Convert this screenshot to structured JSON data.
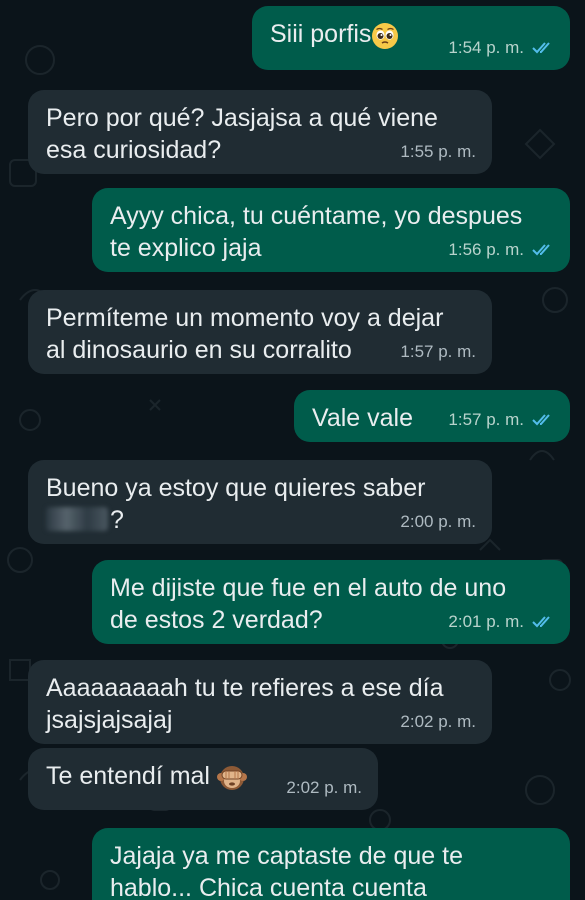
{
  "colors": {
    "background": "#0b141a",
    "incoming_bubble": "#202c33",
    "outgoing_bubble": "#005c4b",
    "text": "#e9edef",
    "read_ticks": "#53bdeb"
  },
  "messages": [
    {
      "direction": "out",
      "text": "Siii porfis",
      "emoji": "pleading-face-emoji",
      "time": "1:54 p. m.",
      "read": true
    },
    {
      "direction": "in",
      "lines": [
        "Pero por qué? Jasjajsa a qué viene",
        "esa curiosidad?"
      ],
      "time": "1:55 p. m."
    },
    {
      "direction": "out",
      "lines": [
        "Ayyy chica, tu cuéntame, yo despues",
        "te explico jaja"
      ],
      "time": "1:56 p. m.",
      "read": true
    },
    {
      "direction": "in",
      "lines": [
        "Permíteme un momento voy a dejar",
        "al dinosaurio en su corralito"
      ],
      "time": "1:57 p. m."
    },
    {
      "direction": "out",
      "text": "Vale vale",
      "time": "1:57 p. m.",
      "read": true
    },
    {
      "direction": "in",
      "lines": [
        "Bueno ya estoy que quieres saber",
        "?"
      ],
      "redacted_name": true,
      "time": "2:00 p. m."
    },
    {
      "direction": "out",
      "lines": [
        "Me dijiste que fue en el auto de uno",
        "de estos 2 verdad?"
      ],
      "time": "2:01 p. m.",
      "read": true
    },
    {
      "direction": "in",
      "lines": [
        "Aaaaaaaaah tu te refieres a ese día",
        "jsajsjajsajaj"
      ],
      "time": "2:02 p. m."
    },
    {
      "direction": "in",
      "text": "Te entendí mal",
      "emoji": "see-no-evil-monkey-emoji",
      "time": "2:02 p. m."
    },
    {
      "direction": "out",
      "lines": [
        "Jajaja ya me captaste de que te",
        "hablo... Chica cuenta cuenta"
      ],
      "time": ""
    }
  ]
}
